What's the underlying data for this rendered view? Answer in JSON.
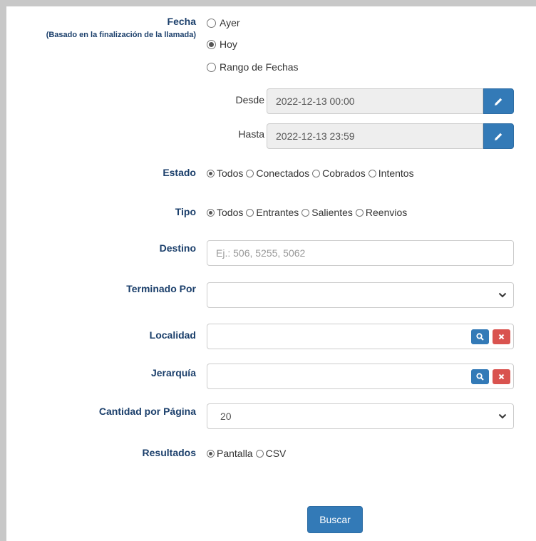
{
  "fecha": {
    "label": "Fecha",
    "sublabel": "(Basado en la finalización de la llamada)",
    "options": [
      "Ayer",
      "Hoy",
      "Rango de Fechas"
    ],
    "selected": "Hoy"
  },
  "desde": {
    "label": "Desde",
    "value": "2022-12-13 00:00"
  },
  "hasta": {
    "label": "Hasta",
    "value": "2022-12-13 23:59"
  },
  "estado": {
    "label": "Estado",
    "options": [
      "Todos",
      "Conectados",
      "Cobrados",
      "Intentos"
    ],
    "selected": "Todos"
  },
  "tipo": {
    "label": "Tipo",
    "options": [
      "Todos",
      "Entrantes",
      "Salientes",
      "Reenvios"
    ],
    "selected": "Todos"
  },
  "destino": {
    "label": "Destino",
    "placeholder": "Ej.: 506, 5255, 5062",
    "value": ""
  },
  "terminado_por": {
    "label": "Terminado Por",
    "value": ""
  },
  "localidad": {
    "label": "Localidad",
    "value": ""
  },
  "jerarquia": {
    "label": "Jerarquía",
    "value": ""
  },
  "cantidad": {
    "label": "Cantidad por Página",
    "value": "20"
  },
  "resultados": {
    "label": "Resultados",
    "options": [
      "Pantalla",
      "CSV"
    ],
    "selected": "Pantalla"
  },
  "buscar_label": "Buscar",
  "colors": {
    "primary": "#337ab7",
    "danger": "#d9534f",
    "label": "#1b3f6b"
  }
}
